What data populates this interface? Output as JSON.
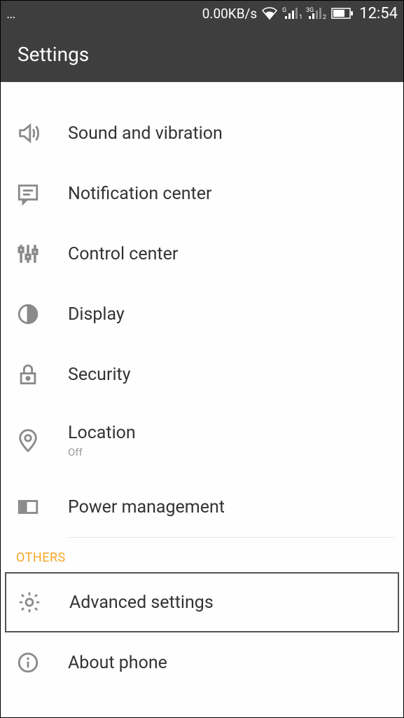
{
  "status": {
    "ellipsis": "…",
    "net_speed": "0.00KB/s",
    "sig1_label": "G",
    "sig2_label": "3G",
    "sig2_sub": "2",
    "time": "12:54"
  },
  "header": {
    "title": "Settings"
  },
  "items": [
    {
      "label": "Sound and vibration"
    },
    {
      "label": "Notification center"
    },
    {
      "label": "Control center"
    },
    {
      "label": "Display"
    },
    {
      "label": "Security"
    },
    {
      "label": "Location",
      "sub": "Off"
    },
    {
      "label": "Power management"
    }
  ],
  "section": {
    "title": "OTHERS"
  },
  "others": [
    {
      "label": "Advanced settings"
    },
    {
      "label": "About phone"
    }
  ]
}
